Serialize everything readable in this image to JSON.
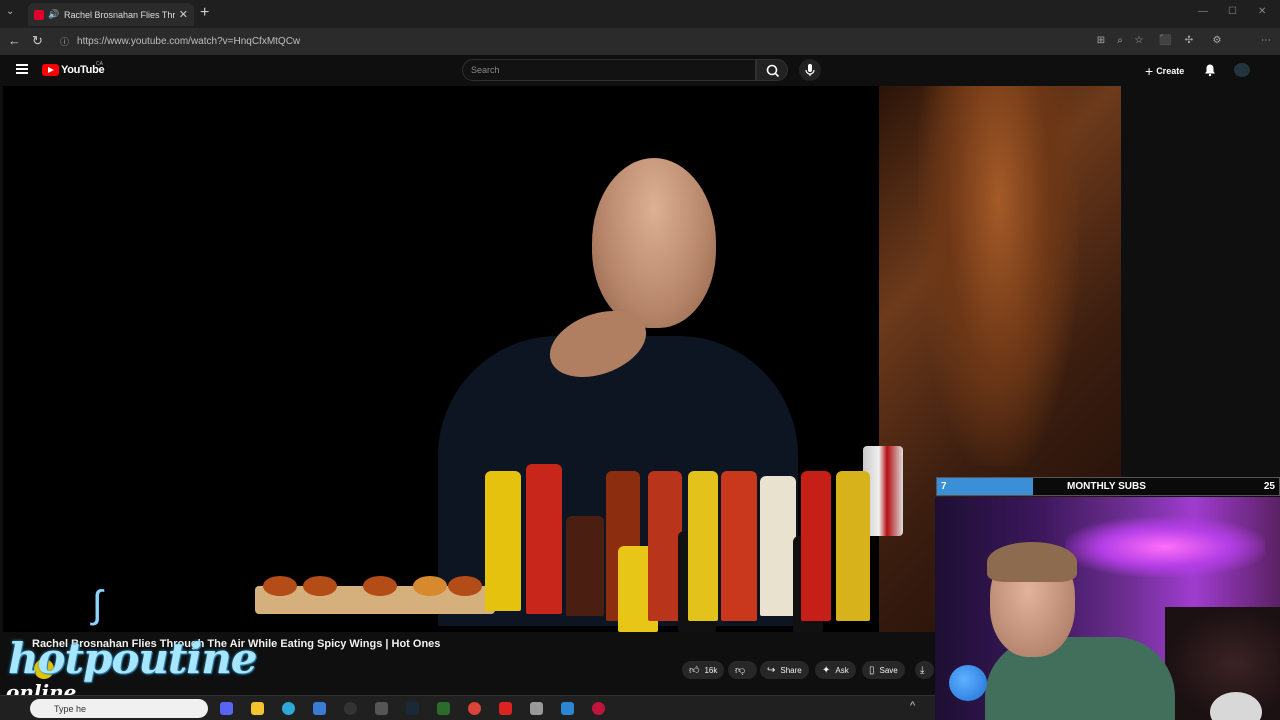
{
  "browser": {
    "tab_title": "Rachel Brosnahan Flies Throu",
    "url": "https://www.youtube.com/watch?v=HnqCfxMtQCw"
  },
  "youtube": {
    "logo_text": "YouTube",
    "region": "CA",
    "search_placeholder": "Search",
    "create_label": "Create"
  },
  "video": {
    "title": "Rachel Brosnahan Flies Through The Air While Eating Spicy Wings | Hot Ones",
    "likes": "16k",
    "share_label": "Share",
    "ask_label": "Ask",
    "save_label": "Save"
  },
  "overlay": {
    "brand_text": "hotpoutine",
    "brand_subtext": "online",
    "subs_label": "MONTHLY SUBS",
    "subs_current": "7",
    "subs_goal": "25",
    "subs_fraction": 0.28
  },
  "taskbar": {
    "search_text": "Type he"
  },
  "colors": {
    "youtube_red": "#ff0000",
    "subs_fill": "#3a8fd6",
    "brand_blue": "#a7e6ff"
  }
}
